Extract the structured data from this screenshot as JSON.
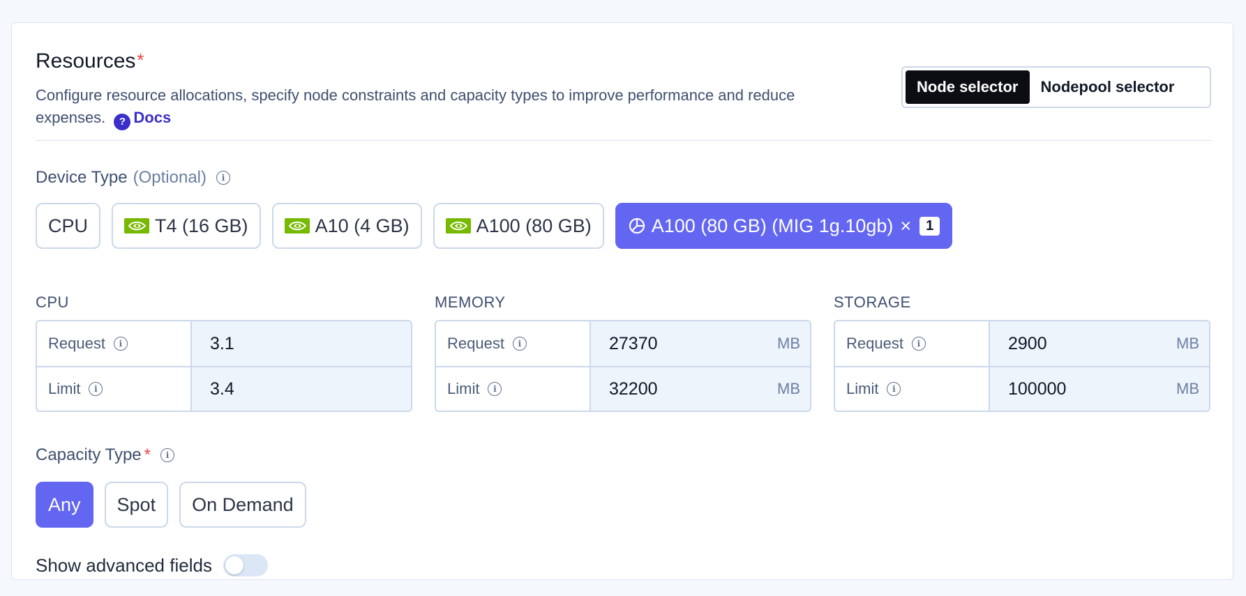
{
  "header": {
    "title": "Resources",
    "required_mark": "*",
    "description": "Configure resource allocations, specify node constraints and capacity types to improve performance and reduce expenses.",
    "docs_label": "Docs",
    "help_icon": "question-circle-icon"
  },
  "selector": {
    "options": [
      "Node selector",
      "Nodepool selector"
    ],
    "selected": "Node selector"
  },
  "device_type": {
    "label": "Device Type",
    "optional": "(Optional)",
    "options": [
      {
        "label": "CPU",
        "icon": ""
      },
      {
        "label": "T4 (16 GB)",
        "icon": "nvidia-icon"
      },
      {
        "label": "A10 (4 GB)",
        "icon": "nvidia-icon"
      },
      {
        "label": "A100 (80 GB)",
        "icon": "nvidia-icon"
      },
      {
        "label": "A100 (80 GB) (MIG 1g.10gb)",
        "icon": "pie-chart-icon",
        "multiplier": "×",
        "quantity": "1"
      }
    ],
    "selected": "A100 (80 GB) (MIG 1g.10gb)"
  },
  "resources": {
    "cpu": {
      "title": "CPU",
      "request_label": "Request",
      "request_value": "3.1",
      "request_unit": "",
      "limit_label": "Limit",
      "limit_value": "3.4",
      "limit_unit": ""
    },
    "memory": {
      "title": "MEMORY",
      "request_label": "Request",
      "request_value": "27370",
      "request_unit": "MB",
      "limit_label": "Limit",
      "limit_value": "32200",
      "limit_unit": "MB"
    },
    "storage": {
      "title": "STORAGE",
      "request_label": "Request",
      "request_value": "2900",
      "request_unit": "MB",
      "limit_label": "Limit",
      "limit_value": "100000",
      "limit_unit": "MB"
    }
  },
  "capacity_type": {
    "label": "Capacity Type",
    "required_mark": "*",
    "options": [
      "Any",
      "Spot",
      "On Demand"
    ],
    "selected": "Any"
  },
  "advanced": {
    "label": "Show advanced fields",
    "enabled": false
  },
  "colors": {
    "accent": "#6366f1",
    "link": "#3b2fc9",
    "required": "#ef4444",
    "nvidia_green": "#76b900"
  }
}
